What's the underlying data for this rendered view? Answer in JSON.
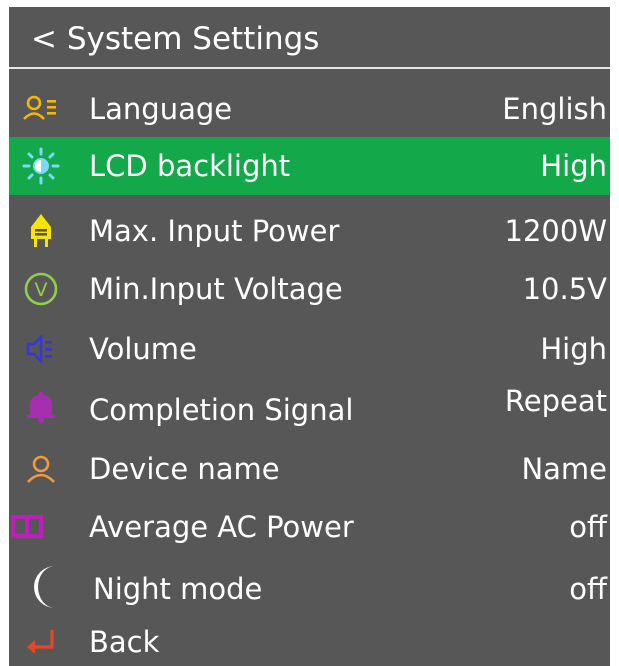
{
  "header": {
    "title": "< System Settings"
  },
  "colors": {
    "background": "#575757",
    "selected": "#13a84a",
    "text": "#ffffff"
  },
  "settings": [
    {
      "label": "Language",
      "value": "English",
      "icon": "person-list-icon",
      "icon_color": "#f5b800"
    },
    {
      "label": "LCD backlight",
      "value": "High",
      "icon": "sun-icon",
      "icon_color": "#7fd6ff",
      "selected": true
    },
    {
      "label": "Max. Input Power",
      "value": "1200W",
      "icon": "plug-icon",
      "icon_color": "#f7e20a"
    },
    {
      "label": "Min.Input Voltage",
      "value": "10.5V",
      "icon": "voltage-icon",
      "icon_color": "#8fd048"
    },
    {
      "label": "Volume",
      "value": "High",
      "icon": "speaker-icon",
      "icon_color": "#3535d8"
    },
    {
      "label": "Completion Signal",
      "value": "Repeat",
      "icon": "bell-icon",
      "icon_color": "#a62fb0"
    },
    {
      "label": "Device name",
      "value": "Name",
      "icon": "user-icon",
      "icon_color": "#f39a3a"
    },
    {
      "label": "Average AC Power",
      "value": "off",
      "icon": "display-icon",
      "icon_color": "#c21cc0"
    },
    {
      "label": "Night mode",
      "value": "off",
      "icon": "moon-icon",
      "icon_color": "#ffffff"
    },
    {
      "label": "Back",
      "value": "",
      "icon": "return-arrow-icon",
      "icon_color": "#e8452a"
    }
  ]
}
